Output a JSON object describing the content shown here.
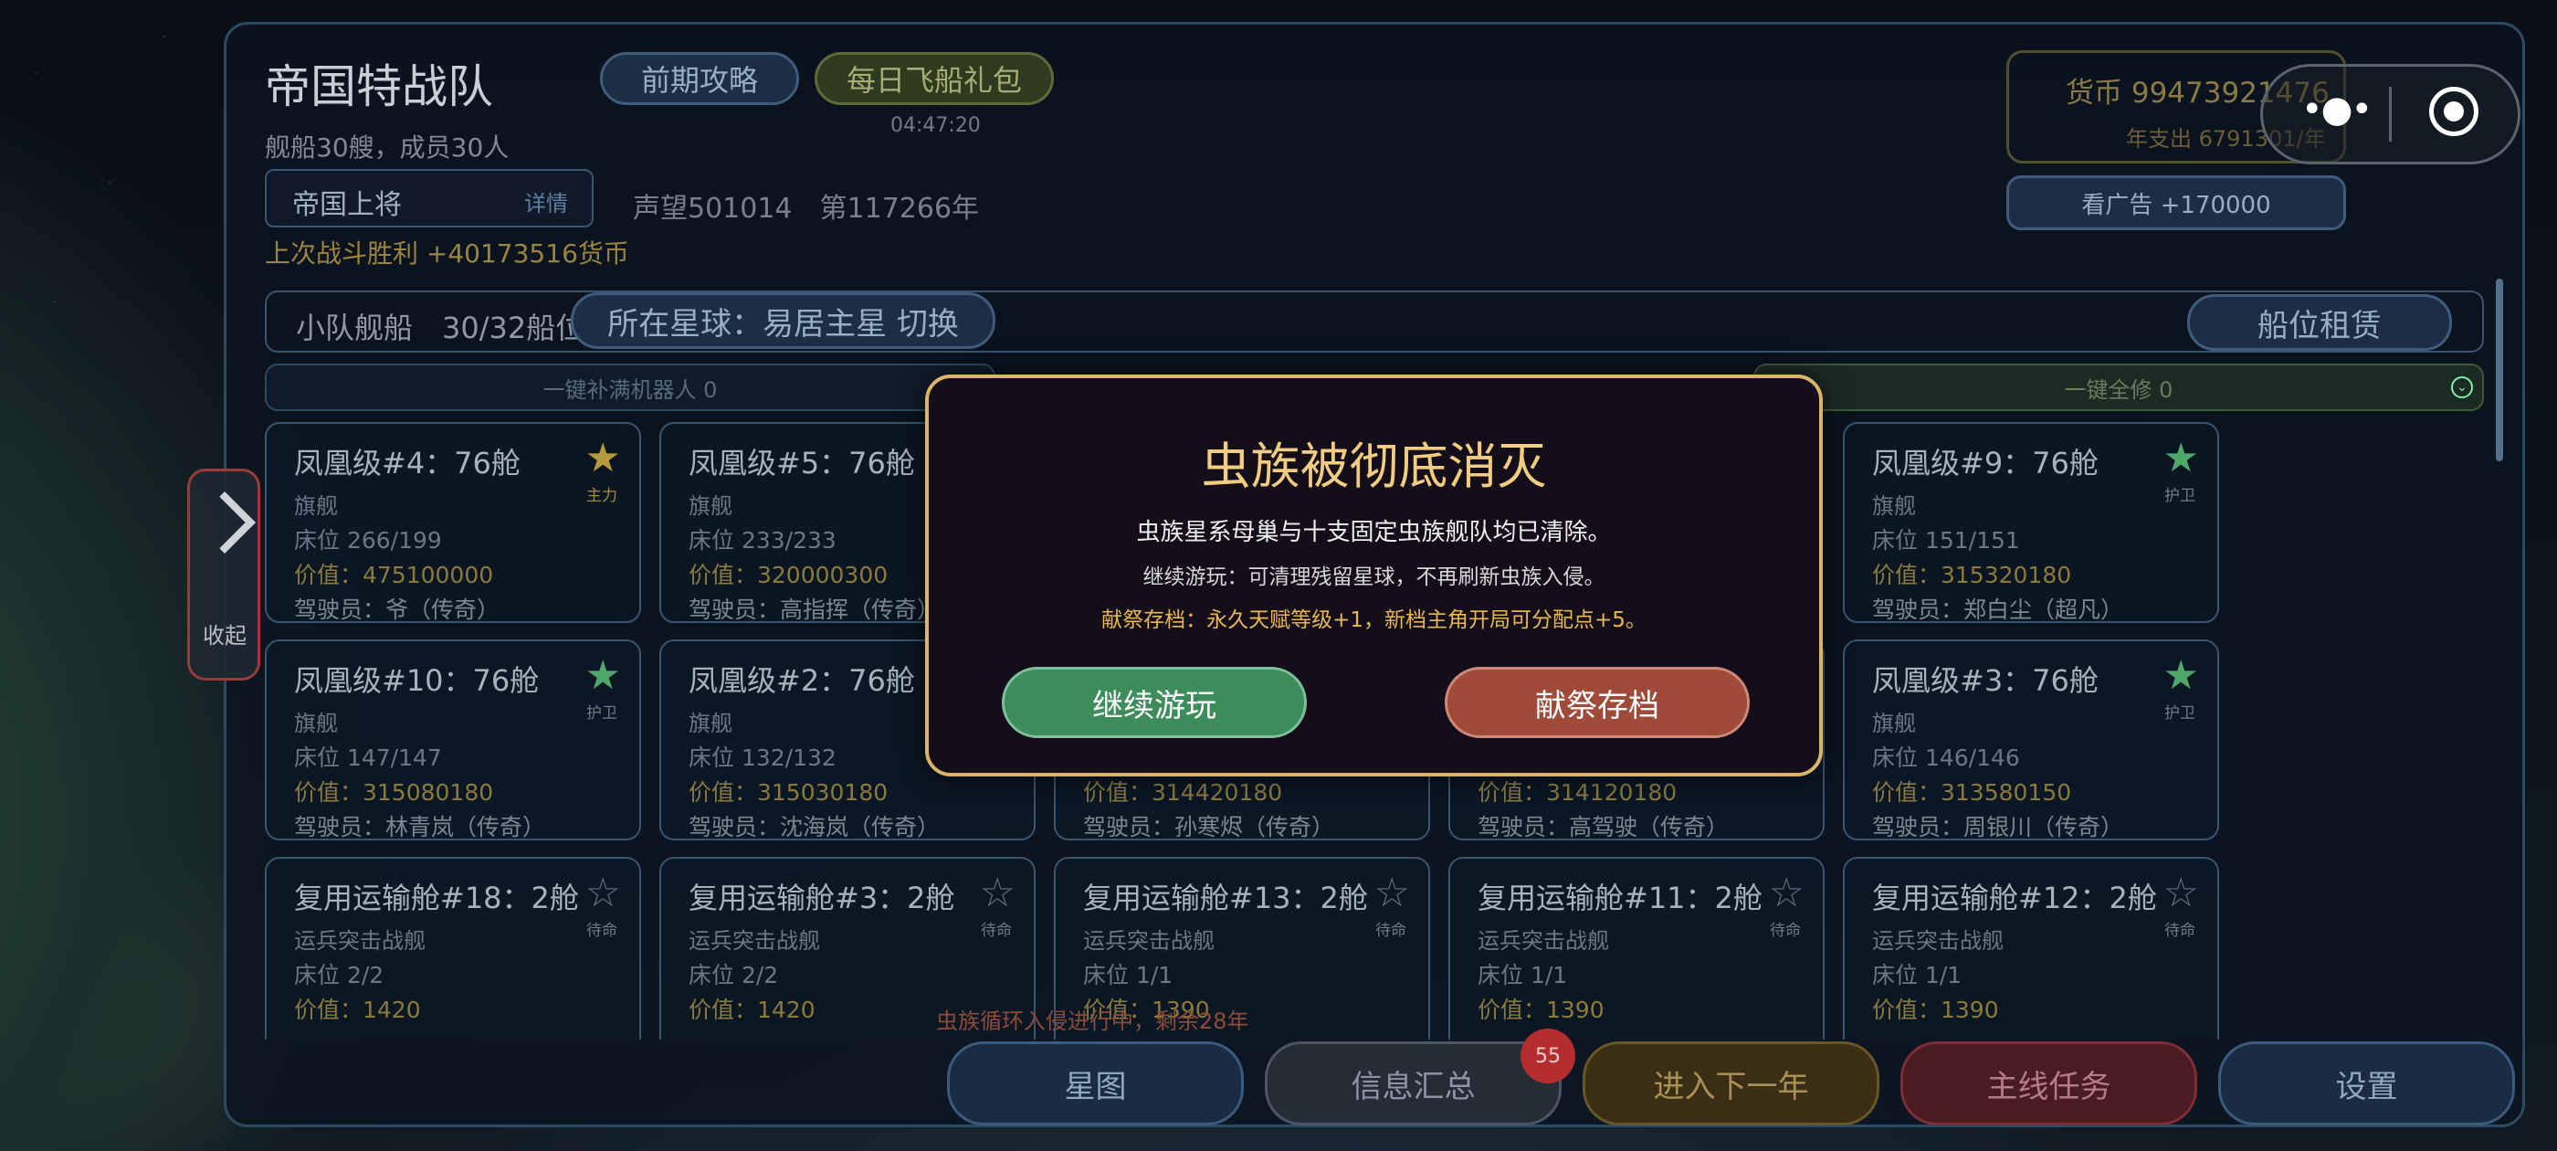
{
  "header": {
    "team_name": "帝国特战队",
    "fleet_summary": "舰船30艘，成员30人",
    "guide_button": "前期攻略",
    "gift_button": "每日飞船礼包",
    "gift_timer": "04:47:20",
    "rank": "帝国上将",
    "rank_detail": "详情",
    "fame_year": "声望501014　第117266年",
    "last_battle": "上次战斗胜利 +40173516货币",
    "currency": "货币 99473921476",
    "annual_spend": "年支出 6791301/年",
    "ad_button": "看广告 +170000"
  },
  "ship_bar": {
    "label": "小队舰船　30/32船位",
    "planet_label": "所在星球：易居主星  切换",
    "rent_button": "船位租赁",
    "refill_button": "一键补满机器人 0",
    "repair_button": "一键全修 0"
  },
  "cards_row1": [
    {
      "name": "凤凰级#4：76舱",
      "type": "旗舰",
      "bed": "床位 266/199",
      "value": "价值：475100000",
      "pilot": "驾驶员：爷（传奇）",
      "role": "主力",
      "star": "gold"
    },
    {
      "name": "凤凰级#5：76舱",
      "type": "旗舰",
      "bed": "床位 233/233",
      "value": "价值：320000300",
      "pilot": "驾驶员：高指挥（传奇）",
      "role": "",
      "star": ""
    },
    {
      "name": "凤凰级#9：76舱",
      "type": "旗舰",
      "bed": "床位 151/151",
      "value": "价值：315320180",
      "pilot": "驾驶员：郑白尘（超凡）",
      "role": "护卫",
      "star": "filled"
    }
  ],
  "cards_row2": [
    {
      "name": "凤凰级#10：76舱",
      "type": "旗舰",
      "bed": "床位 147/147",
      "value": "价值：315080180",
      "pilot": "驾驶员：林青岚（传奇）",
      "role": "护卫",
      "star": "filled"
    },
    {
      "name": "凤凰级#2：76舱",
      "type": "旗舰",
      "bed": "床位 132/132",
      "value": "价值：315030180",
      "pilot": "驾驶员：沈海岚（传奇）",
      "role": "",
      "star": ""
    },
    {
      "name": "",
      "type": "",
      "bed": "",
      "value": "价值：314420180",
      "pilot": "驾驶员：孙寒烬（传奇）",
      "role": "",
      "star": ""
    },
    {
      "name": "",
      "type": "",
      "bed": "",
      "value": "价值：314120180",
      "pilot": "驾驶员：高驾驶（传奇）",
      "role": "",
      "star": ""
    },
    {
      "name": "凤凰级#3：76舱",
      "type": "旗舰",
      "bed": "床位 146/146",
      "value": "价值：313580150",
      "pilot": "驾驶员：周银川（传奇）",
      "role": "护卫",
      "star": "filled"
    }
  ],
  "cards_row3": [
    {
      "name": "复用运输舱#18：2舱",
      "type": "运兵突击战舰",
      "bed": "床位 2/2",
      "value": "价值：1420",
      "role": "待命"
    },
    {
      "name": "复用运输舱#3：2舱",
      "type": "运兵突击战舰",
      "bed": "床位 2/2",
      "value": "价值：1420",
      "role": "待命"
    },
    {
      "name": "复用运输舱#13：2舱",
      "type": "运兵突击战舰",
      "bed": "床位 1/1",
      "value": "价值：1390",
      "role": "待命"
    },
    {
      "name": "复用运输舱#11：2舱",
      "type": "运兵突击战舰",
      "bed": "床位 1/1",
      "value": "价值：1390",
      "role": "待命"
    },
    {
      "name": "复用运输舱#12：2舱",
      "type": "运兵突击战舰",
      "bed": "床位 1/1",
      "value": "价值：1390",
      "role": "待命"
    }
  ],
  "side": {
    "collapse_label": "收起"
  },
  "invasion_notice": "虫族循环入侵进行中，剩余28年",
  "nav": {
    "map": "星图",
    "info": "信息汇总",
    "info_badge": "55",
    "next_year": "进入下一年",
    "main_quest": "主线任务",
    "settings": "设置"
  },
  "modal": {
    "title": "虫族被彻底消灭",
    "line1": "虫族星系母巢与十支固定虫族舰队均已清除。",
    "line2": "继续游玩：可清理残留星球，不再刷新虫族入侵。",
    "line3": "献祭存档：永久天赋等级+1，新档主角开局可分配点+5。",
    "continue_button": "继续游玩",
    "sacrifice_button": "献祭存档"
  },
  "colors": {
    "modal_border": "#d9b46a",
    "continue_green": "#3d8c5c",
    "sacrifice_red": "#a04a3a"
  }
}
